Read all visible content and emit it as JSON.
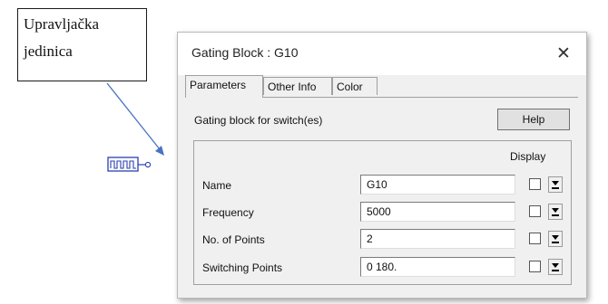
{
  "annotation": {
    "lines": [
      "Upravljačka",
      "jedinica"
    ]
  },
  "dialog": {
    "title": "Gating Block : G10",
    "close_symbol": "✕",
    "tabs": [
      {
        "label": "Parameters",
        "active": true
      },
      {
        "label": "Other Info",
        "active": false
      },
      {
        "label": "Color",
        "active": false
      }
    ],
    "description": "Gating block for switch(es)",
    "help_label": "Help",
    "display_header": "Display",
    "rows": [
      {
        "label": "Name",
        "value": "G10",
        "display_checked": false
      },
      {
        "label": "Frequency",
        "value": "5000",
        "display_checked": false
      },
      {
        "label": "No. of Points",
        "value": "2",
        "display_checked": false
      },
      {
        "label": "Switching Points",
        "value": "0 180.",
        "display_checked": false
      }
    ]
  },
  "colors": {
    "arrow": "#4a72c4",
    "gate_symbol": "#2a3fb0"
  },
  "icons": {
    "gate_symbol": "gating-block-symbol-icon",
    "arrow": "pointer-arrow-icon"
  }
}
